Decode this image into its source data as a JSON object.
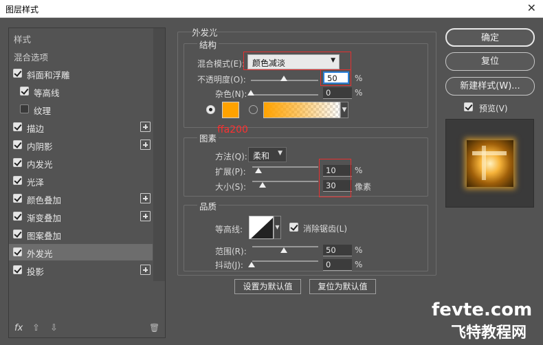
{
  "window": {
    "title": "图层样式",
    "close_glyph": "✕"
  },
  "left": {
    "header": "样式",
    "blend_options": "混合选项",
    "items": [
      {
        "label": "斜面和浮雕",
        "checked": true,
        "plus": false,
        "indent": false
      },
      {
        "label": "等高线",
        "checked": true,
        "plus": false,
        "indent": true
      },
      {
        "label": "纹理",
        "checked": false,
        "plus": false,
        "indent": true
      },
      {
        "label": "描边",
        "checked": true,
        "plus": true,
        "indent": false
      },
      {
        "label": "内阴影",
        "checked": true,
        "plus": true,
        "indent": false
      },
      {
        "label": "内发光",
        "checked": true,
        "plus": false,
        "indent": false
      },
      {
        "label": "光泽",
        "checked": true,
        "plus": false,
        "indent": false
      },
      {
        "label": "颜色叠加",
        "checked": true,
        "plus": true,
        "indent": false
      },
      {
        "label": "渐变叠加",
        "checked": true,
        "plus": true,
        "indent": false
      },
      {
        "label": "图案叠加",
        "checked": true,
        "plus": false,
        "indent": false
      },
      {
        "label": "外发光",
        "checked": true,
        "plus": false,
        "indent": false,
        "selected": true
      },
      {
        "label": "投影",
        "checked": true,
        "plus": true,
        "indent": false
      }
    ],
    "bottom": {
      "fx": "fx",
      "up": "⇧",
      "down": "⇩",
      "trash": "🗑"
    }
  },
  "outer_glow": {
    "title": "外发光",
    "structure": {
      "title": "结构",
      "blend_mode_label": "混合模式(E):",
      "blend_mode_value": "颜色减淡",
      "opacity_label": "不透明度(O):",
      "opacity_value": "50",
      "noise_label": "杂色(N):",
      "noise_value": "0",
      "percent": "%",
      "color_annotation": "ffa200",
      "glow_color": "#ffa200"
    },
    "elements": {
      "title": "图素",
      "method_label": "方法(Q):",
      "method_value": "柔和",
      "spread_label": "扩展(P):",
      "spread_value": "10",
      "size_label": "大小(S):",
      "size_value": "30",
      "size_unit": "像素"
    },
    "quality": {
      "title": "品质",
      "contour_label": "等高线:",
      "antialias_label": "消除锯齿(L)",
      "range_label": "范围(R):",
      "range_value": "50",
      "jitter_label": "抖动(J):",
      "jitter_value": "0"
    },
    "buttons": {
      "make_default": "设置为默认值",
      "reset_default": "复位为默认值"
    }
  },
  "right": {
    "ok": "确定",
    "reset": "复位",
    "new_style": "新建样式(W)...",
    "preview_label": "预览(V)"
  },
  "watermark": {
    "line1": "fevte.com",
    "line2": "飞特教程网"
  }
}
